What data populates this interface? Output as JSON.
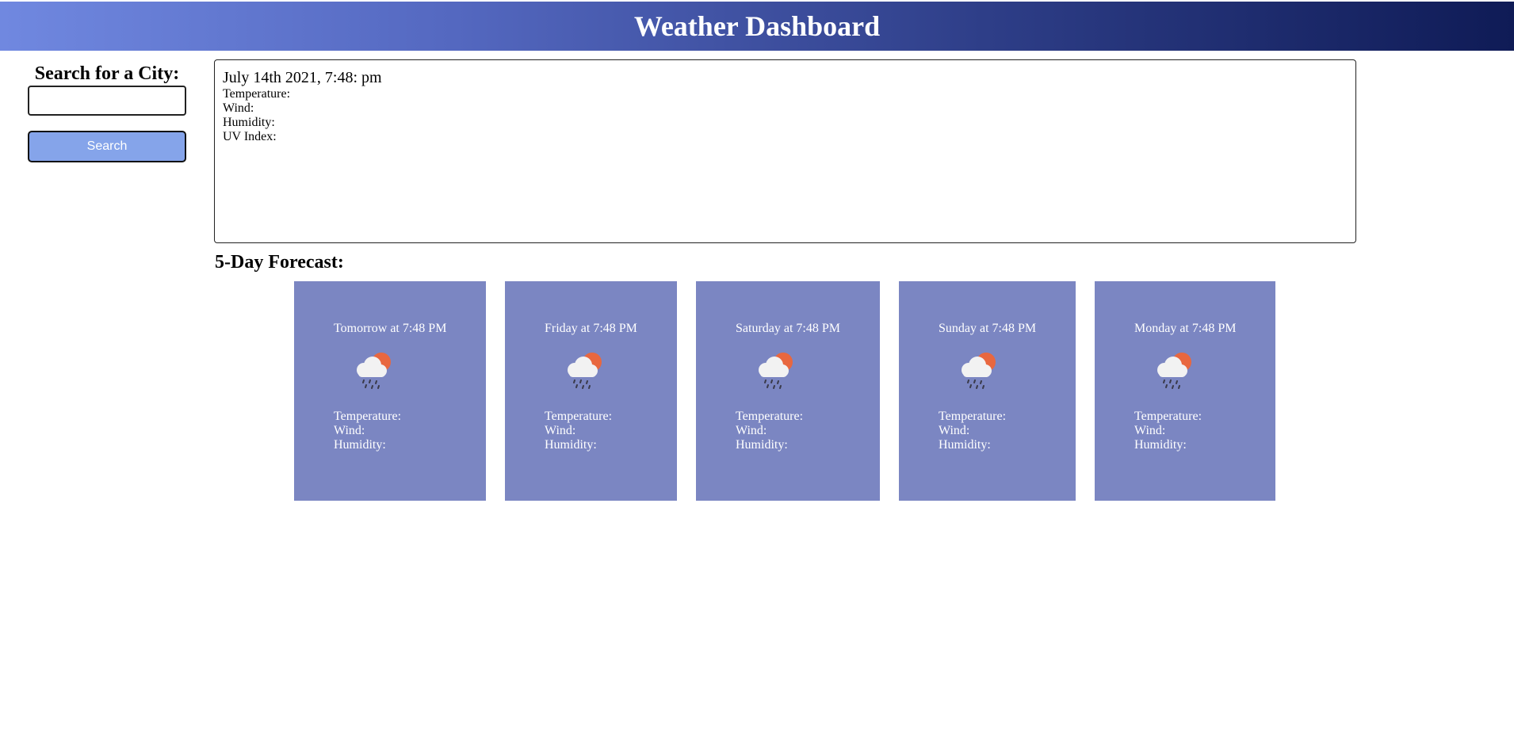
{
  "header": {
    "title": "Weather Dashboard"
  },
  "search": {
    "heading": "Search for a City:",
    "input_value": "",
    "button_label": "Search"
  },
  "current": {
    "datetime": "July 14th 2021, 7:48: pm",
    "temperature_label": "Temperature:",
    "wind_label": "Wind:",
    "humidity_label": "Humidity:",
    "uv_label": "UV Index:"
  },
  "forecast": {
    "title": "5-Day Forecast:",
    "icon": "cloud-sun-rain-icon",
    "days": [
      {
        "label": "Tomorrow at 7:48 PM",
        "temperature": "Temperature:",
        "wind": "Wind:",
        "humidity": "Humidity:"
      },
      {
        "label": "Friday at 7:48 PM",
        "temperature": "Temperature:",
        "wind": "Wind:",
        "humidity": "Humidity:"
      },
      {
        "label": "Saturday at 7:48 PM",
        "temperature": "Temperature:",
        "wind": "Wind:",
        "humidity": "Humidity:"
      },
      {
        "label": "Sunday at 7:48 PM",
        "temperature": "Temperature:",
        "wind": "Wind:",
        "humidity": "Humidity:"
      },
      {
        "label": "Monday at 7:48 PM",
        "temperature": "Temperature:",
        "wind": "Wind:",
        "humidity": "Humidity:"
      }
    ]
  },
  "colors": {
    "header_gradient_start": "#7088e0",
    "header_gradient_end": "#0f1b56",
    "search_button": "#85a4ea",
    "card_background": "#7b86c2",
    "sun": "#e8673f",
    "cloud": "#f2f2f2",
    "rain": "#3a3a4a"
  }
}
